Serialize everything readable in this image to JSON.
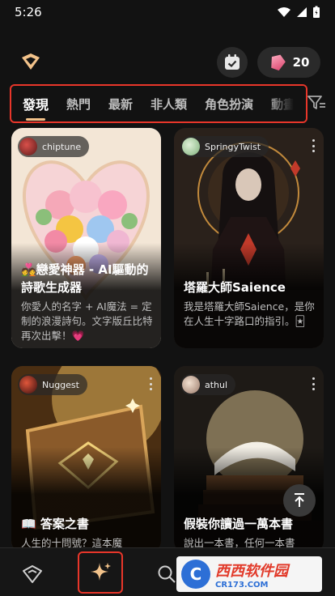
{
  "status_bar": {
    "time": "5:26"
  },
  "header": {
    "gem_count": "20"
  },
  "tabs": [
    {
      "label": "發現",
      "active": true
    },
    {
      "label": "熱門"
    },
    {
      "label": "最新"
    },
    {
      "label": "非人類"
    },
    {
      "label": "角色扮演"
    },
    {
      "label": "動畫"
    }
  ],
  "cards": [
    {
      "author": "chiptune",
      "title": "💑戀愛神器 - AI驅動的詩歌生成器",
      "description": "你愛人的名字 + AI魔法 = 定制的浪漫詩句。文字版丘比特再次出擊！💗"
    },
    {
      "author": "SpringyTwist",
      "title": "塔羅大師Saience",
      "description": "我是塔羅大師Saience，是你在人生十字路口的指引。🃏"
    },
    {
      "author": "Nuggest",
      "title": "📖 答案之書",
      "description": "人生的十問號？這本魔"
    },
    {
      "author": "athul",
      "title": "假裝你讀過一萬本書",
      "description": "說出一本書，任何一本書"
    }
  ],
  "watermark": {
    "main": "西西软件园",
    "sub": "CR173.COM",
    "logo_letter": "C"
  }
}
